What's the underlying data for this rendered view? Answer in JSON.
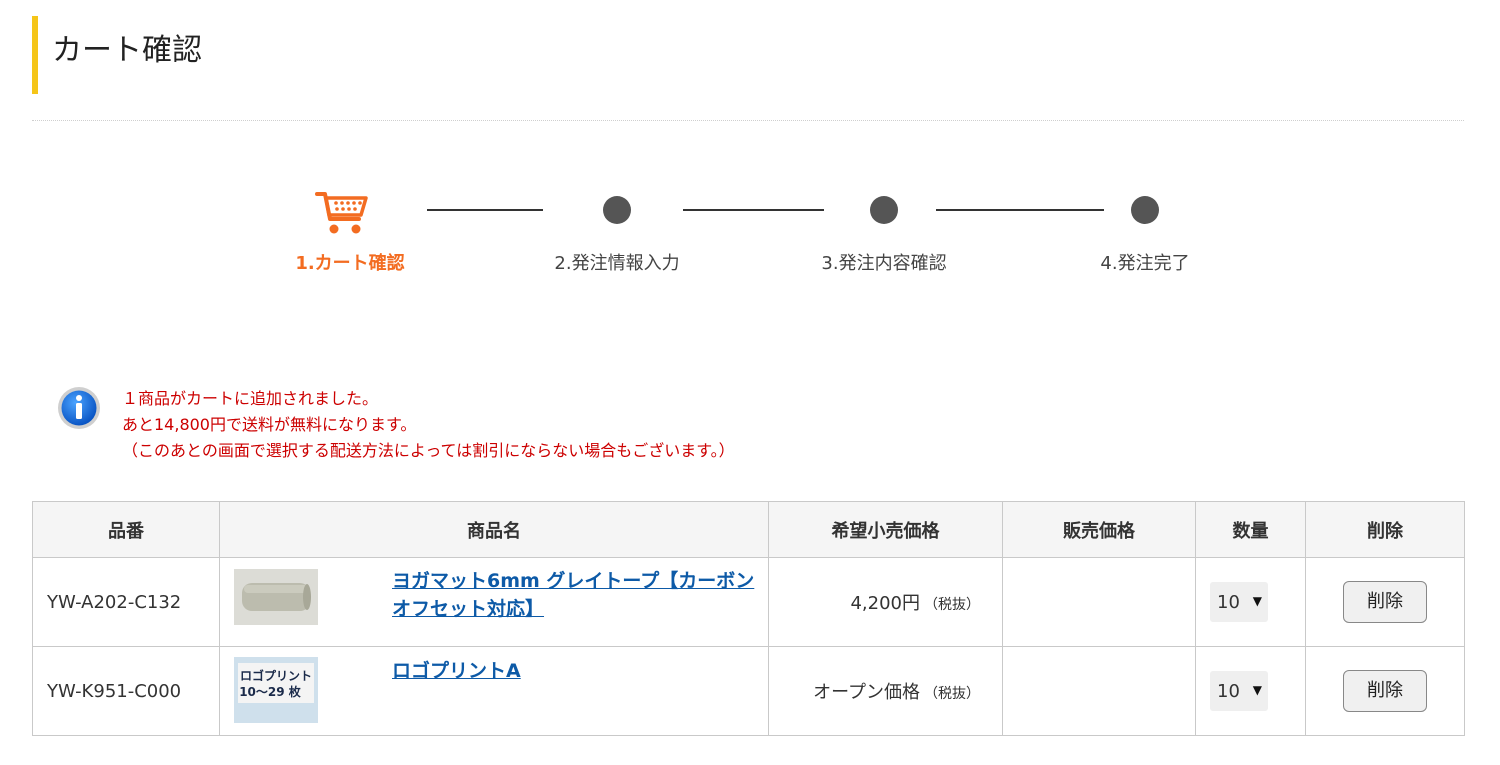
{
  "page": {
    "title": "カート確認"
  },
  "stepper": {
    "steps": [
      {
        "label": "1.カート確認",
        "active": true,
        "icon": "cart-icon"
      },
      {
        "label": "2.発注情報入力",
        "active": false
      },
      {
        "label": "3.発注内容確認",
        "active": false
      },
      {
        "label": "4.発注完了",
        "active": false
      }
    ],
    "active_color": "#f36c21"
  },
  "notice": {
    "icon": "info-icon",
    "lines": [
      "１商品がカートに追加されました。",
      "あと14,800円で送料が無料になります。",
      "（このあとの画面で選択する配送方法によっては割引にならない場合もございます。）"
    ],
    "color": "#cc0000"
  },
  "cart_table": {
    "headers": [
      "品番",
      "商品名",
      "希望小売価格",
      "販売価格",
      "数量",
      "削除"
    ],
    "rows": [
      {
        "code": "YW-A202-C132",
        "name": "ヨガマット6mm グレイトープ【カーボンオフセット対応】",
        "thumb_icon": "yoga-mat-image",
        "price": "4,200円",
        "tax": "（税抜）",
        "sale_price": "",
        "qty": "10",
        "delete_label": "削除"
      },
      {
        "code": "YW-K951-C000",
        "name": "ロゴプリントA",
        "thumb_icon": "logo-print-image",
        "thumb_text": [
          "ロゴプリント",
          "10～29 枚"
        ],
        "price": "オープン価格",
        "tax": "（税抜）",
        "sale_price": "",
        "qty": "10",
        "delete_label": "削除"
      }
    ],
    "link_color": "#0d5aa7"
  }
}
